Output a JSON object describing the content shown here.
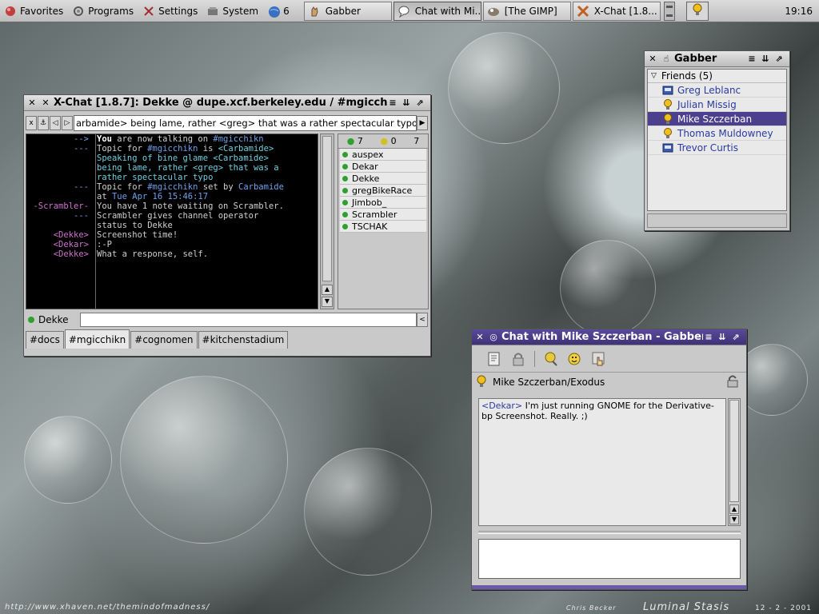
{
  "panel": {
    "menus": [
      {
        "label": "Favorites",
        "icon": "favorites-icon"
      },
      {
        "label": "Programs",
        "icon": "programs-icon"
      },
      {
        "label": "Settings",
        "icon": "settings-icon"
      },
      {
        "label": "System",
        "icon": "system-icon"
      }
    ],
    "workspace_count": "6",
    "tasks": [
      {
        "label": "Gabber"
      },
      {
        "label": "Chat with Mi..."
      },
      {
        "label": "[The GIMP]"
      },
      {
        "label": "X-Chat [1.8..."
      }
    ],
    "clock": "19:16"
  },
  "xchat": {
    "title": "X-Chat [1.8.7]: Dekke @ dupe.xcf.berkeley.edu / #mgicch",
    "topic": "arbamide> being lame, rather <greg> that was a rather spectacular typo",
    "lines": [
      {
        "nick": "-->",
        "segs": [
          {
            "t": "You",
            "c": "c-w"
          },
          {
            "t": " are now talking on "
          },
          {
            "t": "#mgicchikn",
            "c": "c-blue"
          }
        ]
      },
      {
        "nick": "---",
        "segs": [
          {
            "t": "Topic for "
          },
          {
            "t": "#mgicchikn",
            "c": "c-blue"
          },
          {
            "t": " is "
          },
          {
            "t": "<Carbamide>",
            "c": "c-cyan"
          }
        ]
      },
      {
        "nick": "",
        "segs": [
          {
            "t": "Speaking of bine glame <Carbamide>",
            "c": "c-cyan"
          }
        ]
      },
      {
        "nick": "",
        "segs": [
          {
            "t": "being lame, rather <greg> that was a",
            "c": "c-cyan"
          }
        ]
      },
      {
        "nick": "",
        "segs": [
          {
            "t": "rather spectacular typo",
            "c": "c-cyan"
          }
        ]
      },
      {
        "nick": "---",
        "segs": [
          {
            "t": "Topic for "
          },
          {
            "t": "#mgicchikn",
            "c": "c-blue"
          },
          {
            "t": " set by "
          },
          {
            "t": "Carbamide",
            "c": "c-blue"
          }
        ]
      },
      {
        "nick": "",
        "segs": [
          {
            "t": "at "
          },
          {
            "t": "Tue Apr 16 15:46:17",
            "c": "c-blue"
          }
        ]
      },
      {
        "nick": "-Scrambler-",
        "nick_c": "c-mag",
        "segs": [
          {
            "t": "You have 1 note waiting on Scrambler."
          }
        ]
      },
      {
        "nick": "---",
        "segs": [
          {
            "t": "Scrambler gives channel operator"
          }
        ]
      },
      {
        "nick": "",
        "segs": [
          {
            "t": "status to Dekke"
          }
        ]
      },
      {
        "nick": "<Dekke>",
        "nick_c": "c-mag",
        "segs": [
          {
            "t": "Screenshot time!"
          }
        ]
      },
      {
        "nick": "<Dekar>",
        "nick_c": "c-mag",
        "segs": [
          {
            "t": ":-P"
          }
        ]
      },
      {
        "nick": "<Dekke>",
        "nick_c": "c-mag",
        "segs": [
          {
            "t": "What a response, self."
          }
        ]
      }
    ],
    "user_counts": [
      "7",
      "0",
      "7"
    ],
    "users": [
      "auspex",
      "Dekar",
      "Dekke",
      "gregBikeRace",
      "Jimbob_",
      "Scrambler",
      "TSCHAK"
    ],
    "nick": "Dekke",
    "tabs": [
      "#docs",
      "#mgicchikn",
      "#cognomen",
      "#kitchenstadium"
    ],
    "active_tab": 1
  },
  "gabber": {
    "title": "Gabber",
    "group": "Friends (5)",
    "contacts": [
      {
        "name": "Greg Leblanc",
        "icon": "pager-icon"
      },
      {
        "name": "Julian Missig",
        "icon": "lightbulb-icon"
      },
      {
        "name": "Mike Szczerban",
        "icon": "lightbulb-icon",
        "selected": true
      },
      {
        "name": "Thomas Muldowney",
        "icon": "lightbulb-icon"
      },
      {
        "name": "Trevor Curtis",
        "icon": "pager-icon"
      }
    ]
  },
  "chat": {
    "title": "Chat with Mike Szczerban - Gabber",
    "with": "Mike Szczerban/Exodus",
    "message_nick": "<Dekar>",
    "message_text": " I'm just running GNOME for the Derivative-bp Screenshot. Really. ;)"
  },
  "footer": {
    "url": "http://www.xhaven.net/themindofmadness/",
    "author": "Chris Becker",
    "theme": "Luminal Stasis",
    "date": "12 - 2 - 2001"
  }
}
